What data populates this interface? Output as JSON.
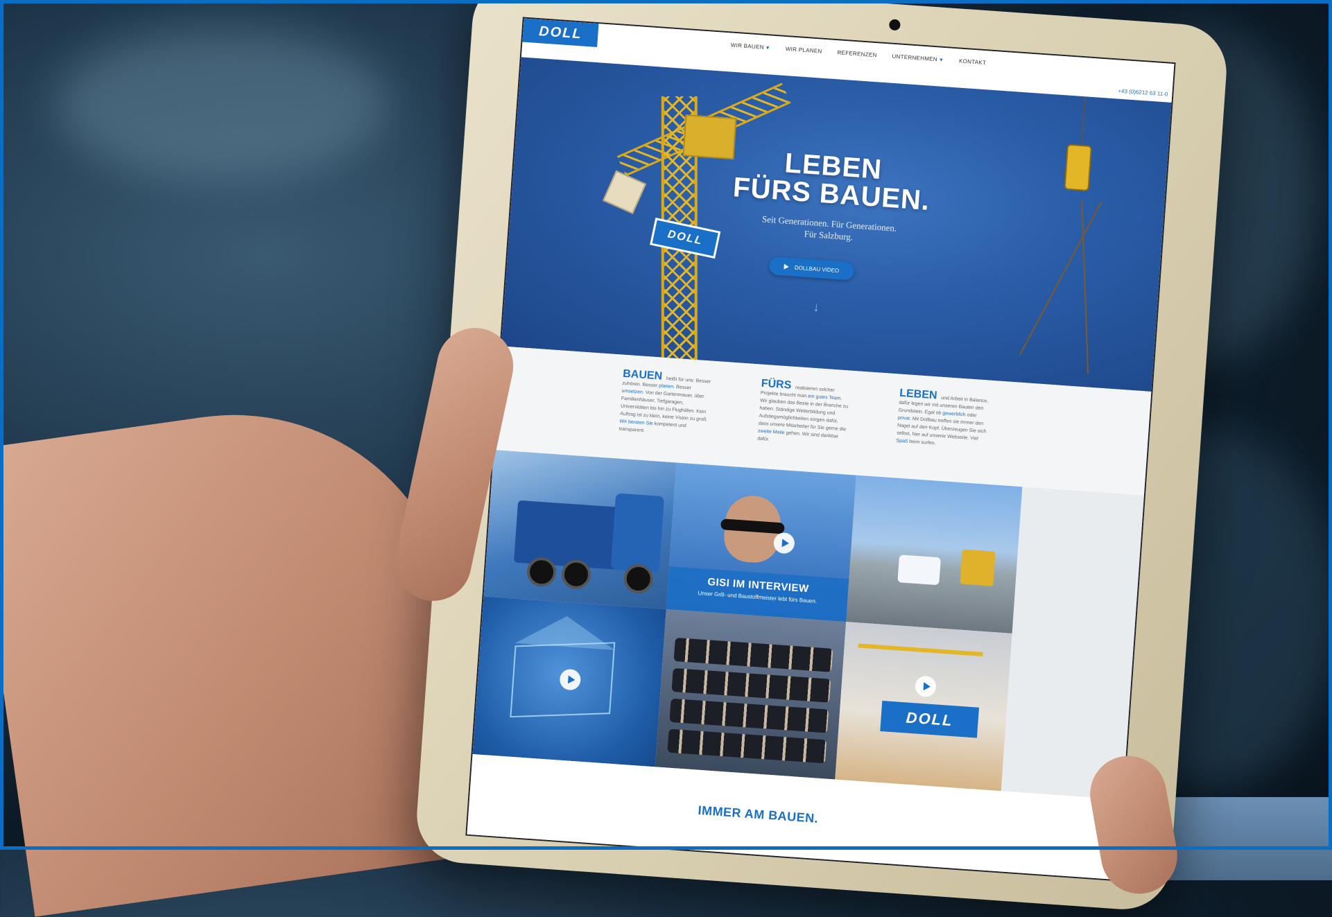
{
  "site": {
    "logo": "DOLL",
    "nav": [
      {
        "label": "WIR BAUEN",
        "dropdown": true
      },
      {
        "label": "WIR PLANEN",
        "dropdown": false
      },
      {
        "label": "REFERENZEN",
        "dropdown": false
      },
      {
        "label": "UNTERNEHMEN",
        "dropdown": true
      },
      {
        "label": "KONTAKT",
        "dropdown": false
      }
    ],
    "phone": "+43 (0)6212 63 11-0"
  },
  "hero": {
    "title_line1": "LEBEN",
    "title_line2": "FÜRS BAUEN.",
    "subtitle_line1": "Seit Generationen. Für Generationen.",
    "subtitle_line2": "Für Salzburg.",
    "video_button": "DOLLBAU VIDEO",
    "crane_sign": "DOLL",
    "scroll_icon": "arrow-down-icon"
  },
  "intro": {
    "col1": {
      "head": "BAUEN",
      "text_a": "heißt für uns: Besser zuhören. Besser",
      "link_a": "planen",
      "text_b": ". Besser",
      "link_b": "umsetzen",
      "text_c": ". Von der Gartenmauer, über Familienhäuser, Tiefgaragen, Universitäten bis hin zu Flughäfen. Kein Auftrag ist zu klein, keine Vision zu groß.",
      "link_c": "Wir beraten Sie",
      "text_d": "kompetent und transparent."
    },
    "col2": {
      "head": "FÜRS",
      "text_a": "realisieren solcher Projekte braucht man",
      "link_a": "ein gutes Team",
      "text_b": ". Wir glauben das Beste in der Branche zu haben. Ständige Weiterbildung und Aufstiegsmöglichkeiten sorgen dafür, dass unsere Mitarbeiter für Sie gerne die",
      "link_b": "zweite Meile",
      "text_c": "gehen. Wir sind dankbar dafür."
    },
    "col3": {
      "head": "LEBEN",
      "text_a": "und Arbeit in Balance, dafür legen wir mit unseren Bauten den Grundstein. Egal ob",
      "link_a": "gewerblich",
      "text_b": "oder",
      "link_b": "privat",
      "text_c": ". Mit Dollbau treffen sie immer den Nagel auf den Kopf. Überzeugen Sie sich selbst, hier auf unserer Webseite. Viel",
      "link_c": "Spaß",
      "text_d": "beim surfen."
    }
  },
  "mosaic": {
    "interview_title": "GISI IM INTERVIEW",
    "interview_sub": "Unser Grill- und Baustoffmeister lebt fürs Bauen.",
    "model_sign": "DOLL"
  },
  "footer": {
    "motto": "IMMER AM BAUEN."
  },
  "colors": {
    "brand_blue": "#1a6fc6",
    "crane_yellow": "#e3b627",
    "frame_blue": "#0a6fc4"
  }
}
